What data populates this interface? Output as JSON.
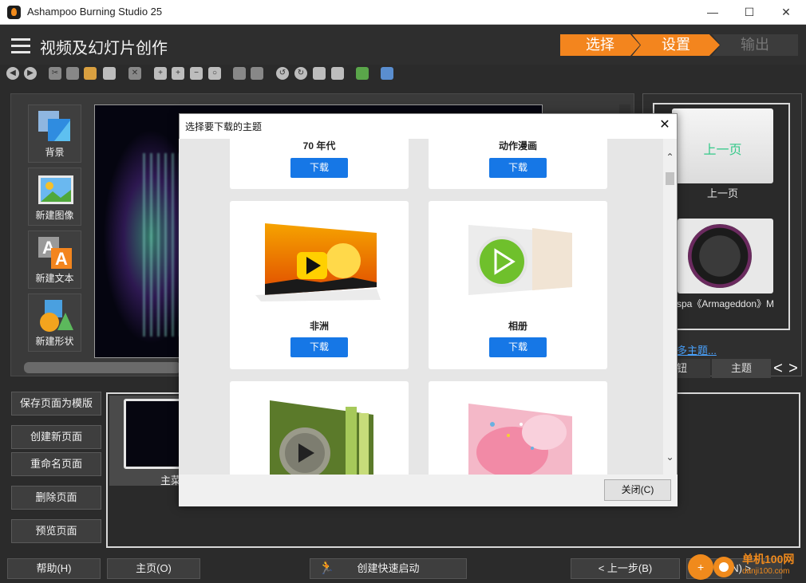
{
  "window": {
    "title": "Ashampoo Burning Studio 25",
    "minimize": "—",
    "maximize": "☐",
    "close": "✕"
  },
  "header": {
    "page_title": "视频及幻灯片创作"
  },
  "steps": {
    "select": "选择",
    "settings": "设置",
    "output": "输出"
  },
  "toolbar": {
    "icons": [
      "back-icon",
      "forward-icon",
      "cut-icon",
      "copy-icon",
      "paste-icon",
      "duplicate-icon",
      "delete-icon",
      "zoom-in-icon",
      "zoom-in-icon",
      "zoom-out-icon",
      "zoom-fit-icon",
      "bring-forward-icon",
      "send-backward-icon",
      "rotate-left-icon",
      "rotate-right-icon",
      "flip-horizontal-icon",
      "flip-vertical-icon",
      "image-icon",
      "arrange-icon"
    ]
  },
  "tools": {
    "background": "背景",
    "new_image": "新建图像",
    "new_text": "新建文本",
    "new_shape": "新建形状"
  },
  "right_panel": {
    "prev_thumb_text": "上一页",
    "prev_caption": "上一页",
    "music_caption": "spa《Armageddon》M",
    "more_link": "多主题...",
    "tab_buttons": "钮",
    "tab_themes": "主题",
    "prev_arrow": "<",
    "next_arrow": ">"
  },
  "page_buttons": {
    "save_as_template": "保存页面为模版",
    "create_page": "创建新页面",
    "rename_page": "重命名页面",
    "delete_page": "删除页面",
    "preview_page": "预览页面"
  },
  "pages": {
    "main_page_label": "主菜"
  },
  "footer": {
    "help": "帮助(H)",
    "home": "主页(O)",
    "quick_start": "创建快速启动",
    "back": "< 上一步(B)",
    "next": "步(N) >"
  },
  "watermark": {
    "text": "单机100网",
    "sub": "danji100.com"
  },
  "dialog": {
    "title": "选择要下载的主题",
    "close_x": "✕",
    "close_button": "关闭(C)",
    "download_label": "下载",
    "themes": [
      {
        "name": "70 年代"
      },
      {
        "name": "动作漫画"
      },
      {
        "name": "非洲"
      },
      {
        "name": "相册"
      },
      {
        "name": ""
      },
      {
        "name": ""
      }
    ],
    "scroll_up": "⌃",
    "scroll_down": "⌄"
  },
  "colors": {
    "accent_orange": "#f3851e",
    "download_blue": "#1677e6",
    "dark_bg": "#2b2b2b"
  }
}
